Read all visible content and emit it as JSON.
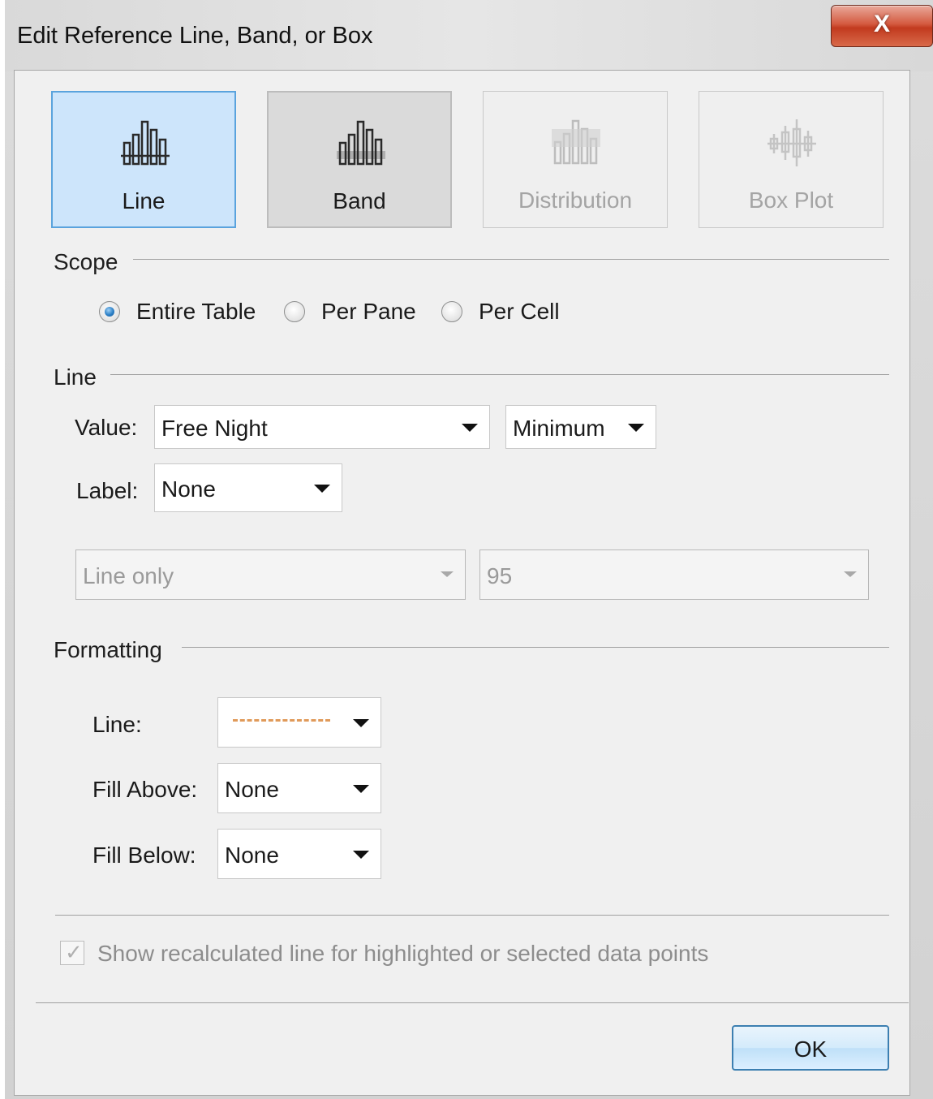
{
  "window": {
    "title": "Edit Reference Line, Band, or Box",
    "close_label": "X"
  },
  "types": [
    {
      "label": "Line",
      "state": "selected"
    },
    {
      "label": "Band",
      "state": "active"
    },
    {
      "label": "Distribution",
      "state": "disabled"
    },
    {
      "label": "Box Plot",
      "state": "disabled"
    }
  ],
  "scope": {
    "heading": "Scope",
    "options": [
      "Entire Table",
      "Per Pane",
      "Per Cell"
    ],
    "selected": "Entire Table"
  },
  "line": {
    "heading": "Line",
    "value_label": "Value:",
    "value_field": "Free Night",
    "aggregation": "Minimum",
    "label_label": "Label:",
    "label_value": "None",
    "line_type": "Line only",
    "percent": "95"
  },
  "formatting": {
    "heading": "Formatting",
    "line_label": "Line:",
    "line_color": "#e09a5a",
    "fill_above_label": "Fill Above:",
    "fill_above": "None",
    "fill_below_label": "Fill Below:",
    "fill_below": "None"
  },
  "recalc": {
    "label": "Show recalculated line for highlighted or selected data points",
    "checked": true,
    "enabled": false
  },
  "footer": {
    "ok_label": "OK"
  }
}
